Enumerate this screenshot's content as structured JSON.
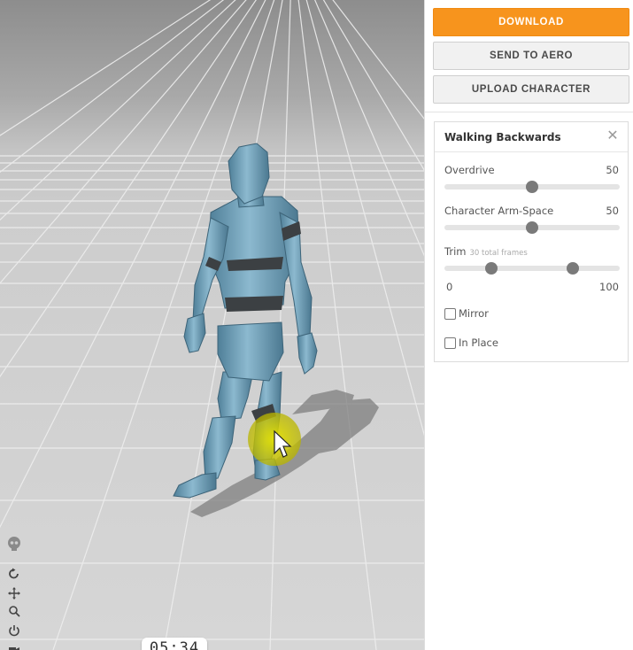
{
  "actions": {
    "download_label": "DOWNLOAD",
    "send_to_aero_label": "SEND TO AERO",
    "upload_character_label": "UPLOAD CHARACTER"
  },
  "animation_panel": {
    "title": "Walking Backwards",
    "close_glyph": "✕",
    "overdrive": {
      "label": "Overdrive",
      "value": "50",
      "fraction": 0.5
    },
    "arm_space": {
      "label": "Character Arm-Space",
      "value": "50",
      "fraction": 0.5
    },
    "trim": {
      "label": "Trim",
      "sublabel": "30 total frames",
      "min_label": "0",
      "max_label": "100",
      "start_fraction": 0.27,
      "end_fraction": 0.73
    },
    "mirror": {
      "label": "Mirror",
      "checked": false
    },
    "in_place": {
      "label": "In Place",
      "checked": false
    }
  },
  "viewport": {
    "timer": "05:34",
    "controls": [
      "skull-icon",
      "rotate-icon",
      "pan-icon",
      "zoom-icon",
      "power-icon",
      "camera-icon"
    ]
  },
  "colors": {
    "accent": "#f7941d",
    "character": "#6f9fb8",
    "cursor_highlight": "#d4d000"
  }
}
